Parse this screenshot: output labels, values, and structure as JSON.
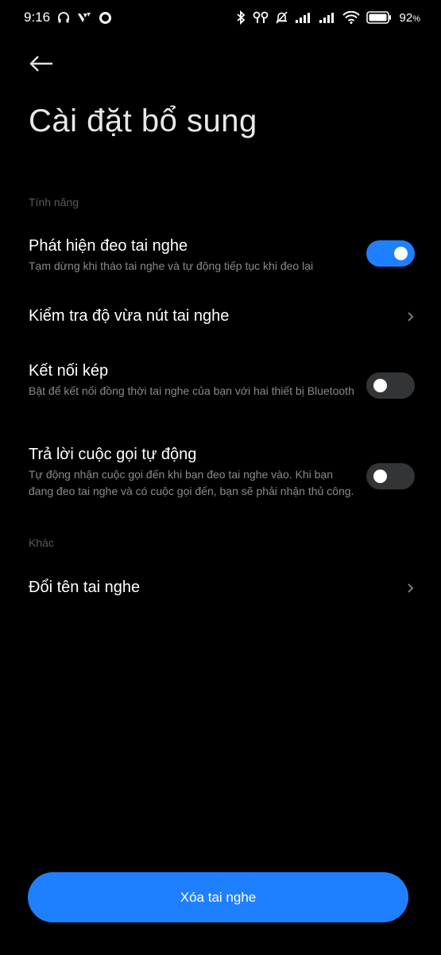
{
  "status_bar": {
    "time": "9:16",
    "battery_level": "92",
    "battery_unit": "%"
  },
  "header": {
    "title": "Cài đặt bổ sung"
  },
  "sections": {
    "features_header": "Tính năng",
    "other_header": "Khác"
  },
  "settings": {
    "wear_detection": {
      "title": "Phát hiện đeo tai nghe",
      "desc": "Tạm dừng khi tháo tai nghe và tự động tiếp tục khi đeo lại",
      "enabled": true
    },
    "fit_test": {
      "title": "Kiểm tra độ vừa nút tai nghe"
    },
    "dual_connection": {
      "title": "Kết nối kép",
      "desc": "Bật để kết nối đồng thời tai nghe của bạn với hai thiết bị Bluetooth",
      "enabled": false
    },
    "auto_answer": {
      "title": "Trả lời cuộc gọi tự động",
      "desc": "Tự động nhận cuộc gọi đến khi bạn đeo tai nghe vào. Khi bạn đang đeo tai nghe và có cuộc gọi đến, bạn sẽ phải nhận thủ công.",
      "enabled": false
    },
    "rename": {
      "title": "Đổi tên tai nghe"
    }
  },
  "footer": {
    "remove_label": "Xóa tai nghe"
  },
  "colors": {
    "accent": "#1f80ff",
    "background": "#000000",
    "toggle_off": "#333436",
    "secondary_text": "#8a8a8a"
  },
  "icons": [
    "headphones-icon",
    "signal-app-icon",
    "circle-icon",
    "bluetooth-icon",
    "earbuds-icon",
    "bell-muted-icon",
    "cell-signal-icon",
    "wifi-icon",
    "battery-icon",
    "back-arrow-icon",
    "chevron-right-icon"
  ]
}
